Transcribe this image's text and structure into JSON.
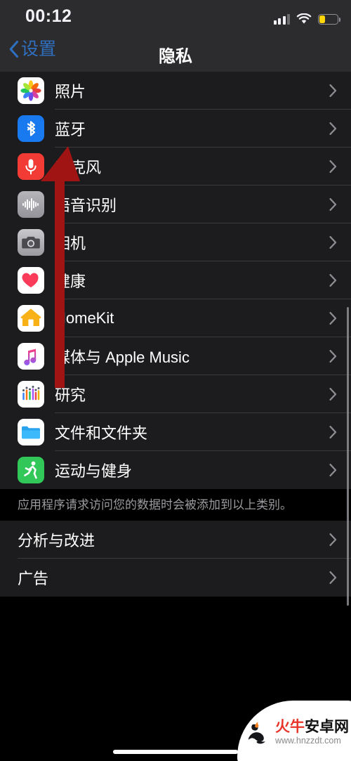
{
  "status_bar": {
    "time": "00:12",
    "signal_icon": "cellular-bars-icon",
    "wifi_icon": "wifi-icon",
    "battery_icon": "battery-low-power-icon",
    "battery_level_percent": 30,
    "battery_color": "#ffd60a"
  },
  "nav": {
    "back_label": "设置",
    "back_icon": "chevron-left-icon",
    "title": "隐私",
    "accent_color": "#2f6fbf"
  },
  "groups": [
    {
      "rows": [
        {
          "label": "照片",
          "icon": "photos-icon",
          "chevron": "chevron-right-icon"
        },
        {
          "label": "蓝牙",
          "icon": "bluetooth-icon",
          "chevron": "chevron-right-icon"
        },
        {
          "label": "麦克风",
          "icon": "microphone-icon",
          "chevron": "chevron-right-icon"
        },
        {
          "label": "语音识别",
          "icon": "speech-icon",
          "chevron": "chevron-right-icon"
        },
        {
          "label": "相机",
          "icon": "camera-icon",
          "chevron": "chevron-right-icon"
        },
        {
          "label": "健康",
          "icon": "health-icon",
          "chevron": "chevron-right-icon"
        },
        {
          "label": "HomeKit",
          "icon": "homekit-icon",
          "chevron": "chevron-right-icon"
        },
        {
          "label": "媒体与 Apple Music",
          "icon": "music-icon",
          "chevron": "chevron-right-icon"
        },
        {
          "label": "研究",
          "icon": "research-icon",
          "chevron": "chevron-right-icon"
        },
        {
          "label": "文件和文件夹",
          "icon": "files-icon",
          "chevron": "chevron-right-icon"
        },
        {
          "label": "运动与健身",
          "icon": "fitness-icon",
          "chevron": "chevron-right-icon"
        }
      ]
    },
    {
      "rows": [
        {
          "label": "分析与改进",
          "icon": null,
          "chevron": "chevron-right-icon"
        },
        {
          "label": "广告",
          "icon": null,
          "chevron": "chevron-right-icon"
        }
      ]
    }
  ],
  "footer_note": "应用程序请求访问您的数据时会被添加到以上类别。",
  "annotation": {
    "arrow_icon": "up-arrow-annotation",
    "color": "#a01414",
    "points_at": "蓝牙"
  },
  "watermark": {
    "logo_icon": "bull-logo-icon",
    "title_hot": "火牛",
    "title_rest": "安卓网",
    "url": "www.hnzzdt.com"
  },
  "home_indicator": "home-indicator-bar"
}
